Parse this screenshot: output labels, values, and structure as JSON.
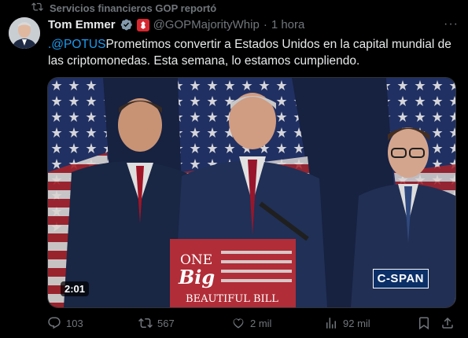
{
  "repost": {
    "label": "Servicios financieros GOP reportó",
    "icon": "repost-icon"
  },
  "author": {
    "name": "Tom Emmer",
    "handle": "@GOPMajorityWhip",
    "separator": "·",
    "time": "1 hora",
    "verified_icon": "verified-badge-icon",
    "affiliation_icon": "gop-affiliation-badge-icon"
  },
  "tweet": {
    "mention": ".@POTUS",
    "text": "Prometimos convertir a Estados Unidos en la capital mundial de las criptomonedas. Esta semana, lo estamos cumpliendo."
  },
  "media": {
    "duration": "2:01",
    "watermark": "C-SPAN",
    "podium_sign": {
      "line1": "ONE",
      "line2": "Big",
      "line3": "BEAUTIFUL BILL"
    }
  },
  "actions": {
    "replies": "103",
    "reposts": "567",
    "likes": "2 mil",
    "views": "92 mil"
  },
  "colors": {
    "accent": "#1d9bf0",
    "muted": "#71767b",
    "text": "#e7e9ea",
    "background": "#000000"
  }
}
